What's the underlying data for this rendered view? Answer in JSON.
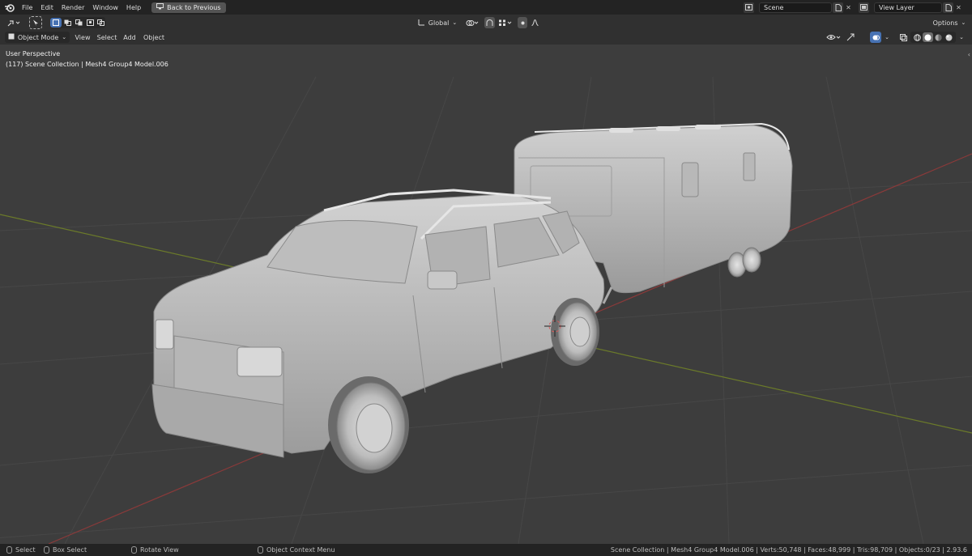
{
  "menu": {
    "file": "File",
    "edit": "Edit",
    "render": "Render",
    "window": "Window",
    "help": "Help",
    "back_to_previous": "Back to Previous"
  },
  "scene": {
    "name": "Scene",
    "view_layer": "View Layer"
  },
  "header": {
    "transform_orientation": "Global",
    "options": "Options",
    "mode": "Object Mode",
    "view": "View",
    "select": "Select",
    "add": "Add",
    "object": "Object"
  },
  "viewport": {
    "perspective": "User Perspective",
    "collection_info": "(117) Scene Collection | Mesh4 Group4 Model.006"
  },
  "status": {
    "select": "Select",
    "box_select": "Box Select",
    "rotate_view": "Rotate View",
    "context_menu": "Object Context Menu",
    "stats": "Scene Collection | Mesh4 Group4 Model.006 | Verts:50,748 | Faces:48,999 | Tris:98,709 | Objects:0/23 | 2.93.6"
  },
  "colors": {
    "accent": "#4772b3",
    "viewport_bg": "#3d3d3d",
    "x_axis": "#8a3a3a",
    "y_axis": "#6b7a2a"
  }
}
